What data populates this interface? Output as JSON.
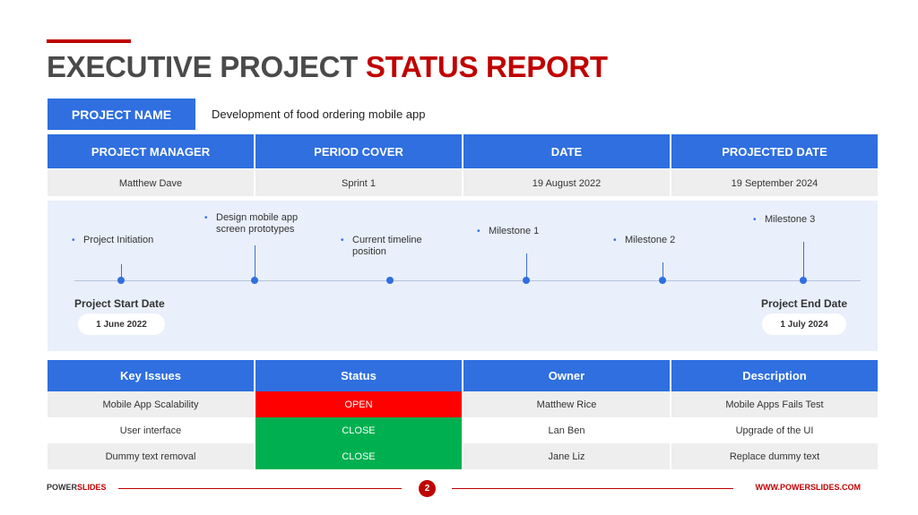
{
  "title": {
    "part1": "EXECUTIVE PROJECT ",
    "part2": "STATUS REPORT"
  },
  "project": {
    "label": "PROJECT NAME",
    "value": "Development of food ordering mobile app"
  },
  "info_table": {
    "headers": [
      "PROJECT MANAGER",
      "PERIOD COVER",
      "DATE",
      "PROJECTED DATE"
    ],
    "values": [
      "Matthew Dave",
      "Sprint 1",
      "19 August 2022",
      "19 September 2024"
    ]
  },
  "timeline": {
    "events": [
      {
        "label": "Project Initiation"
      },
      {
        "label": "Design mobile app screen prototypes"
      },
      {
        "label": "Current timeline position"
      },
      {
        "label": "Milestone 1"
      },
      {
        "label": "Milestone 2"
      },
      {
        "label": "Milestone 3"
      }
    ],
    "start": {
      "title": "Project Start Date",
      "date": "1 June 2022"
    },
    "end": {
      "title": "Project End Date",
      "date": "1 July 2024"
    }
  },
  "issues_table": {
    "headers": [
      "Key Issues",
      "Status",
      "Owner",
      "Description"
    ],
    "rows": [
      {
        "issue": "Mobile App Scalability",
        "status": "OPEN",
        "owner": "Matthew Rice",
        "description": "Mobile Apps Fails Test"
      },
      {
        "issue": "User interface",
        "status": "CLOSE",
        "owner": "Lan Ben",
        "description": "Upgrade of the UI"
      },
      {
        "issue": "Dummy text removal",
        "status": "CLOSE",
        "owner": "Jane Liz",
        "description": "Replace dummy text"
      }
    ]
  },
  "footer": {
    "brand_part1": "POWER",
    "brand_part2": "SLIDES",
    "page": "2",
    "url": "WWW.POWERSLIDES.COM"
  },
  "colors": {
    "accent_red": "#c00000",
    "primary_blue": "#2f6fe0",
    "open_red": "#ff0000",
    "close_green": "#00b050"
  }
}
